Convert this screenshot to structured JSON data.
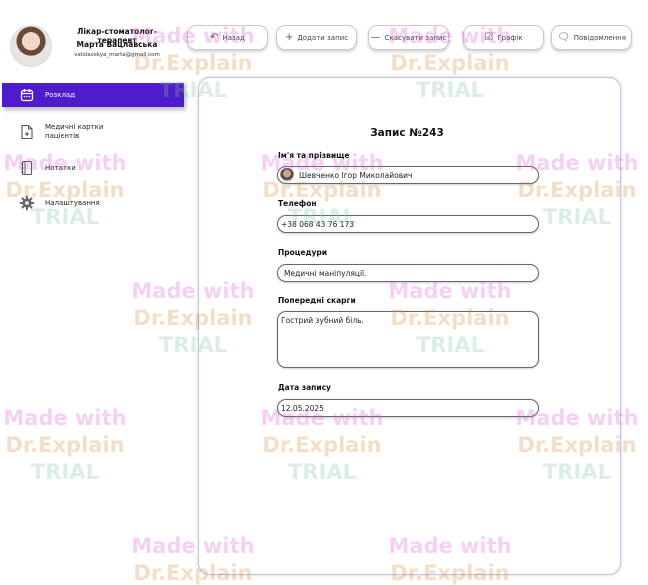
{
  "profile": {
    "role": "Лікар-стоматолог-терапевт",
    "name": "Марта Вацлавська",
    "email": "vatslavskya_marta@gmail.com"
  },
  "sidebar": {
    "items": [
      {
        "label": "Розклад",
        "icon": "calendar-icon",
        "active": true
      },
      {
        "label": "Медичні картки пацієнтів",
        "icon": "medical-file-icon",
        "active": false
      },
      {
        "label": "Нотатки",
        "icon": "notebook-icon",
        "active": false
      },
      {
        "label": "Налаштування",
        "icon": "gear-icon",
        "active": false
      }
    ]
  },
  "toolbar": {
    "back_label": "Назад",
    "add_label": "Додати запис",
    "cancel_label": "Скасувати запис",
    "schedule_label": "Графік",
    "messages_label": "Повідомлення"
  },
  "form": {
    "title": "Запис №243",
    "name_label": "Ім'я та прізвище",
    "name_value": "Шевченко Ігор Миколайович",
    "phone_label": "Телефон",
    "phone_value": "+38 068 43 76 173",
    "procedures_label": "Процедури",
    "procedures_value": "Медичні маніпуляції.",
    "complaints_label": "Попередні скарги",
    "complaints_value": "Гострий зубний біль.",
    "date_label": "Дата запису",
    "date_value": "12.05.2025"
  },
  "watermark": {
    "line1": "Made with",
    "line2": "Dr.Explain",
    "line3": "TRIAL"
  },
  "colors": {
    "accent": "#4e1ccd",
    "card_border": "#c8c0e0"
  }
}
